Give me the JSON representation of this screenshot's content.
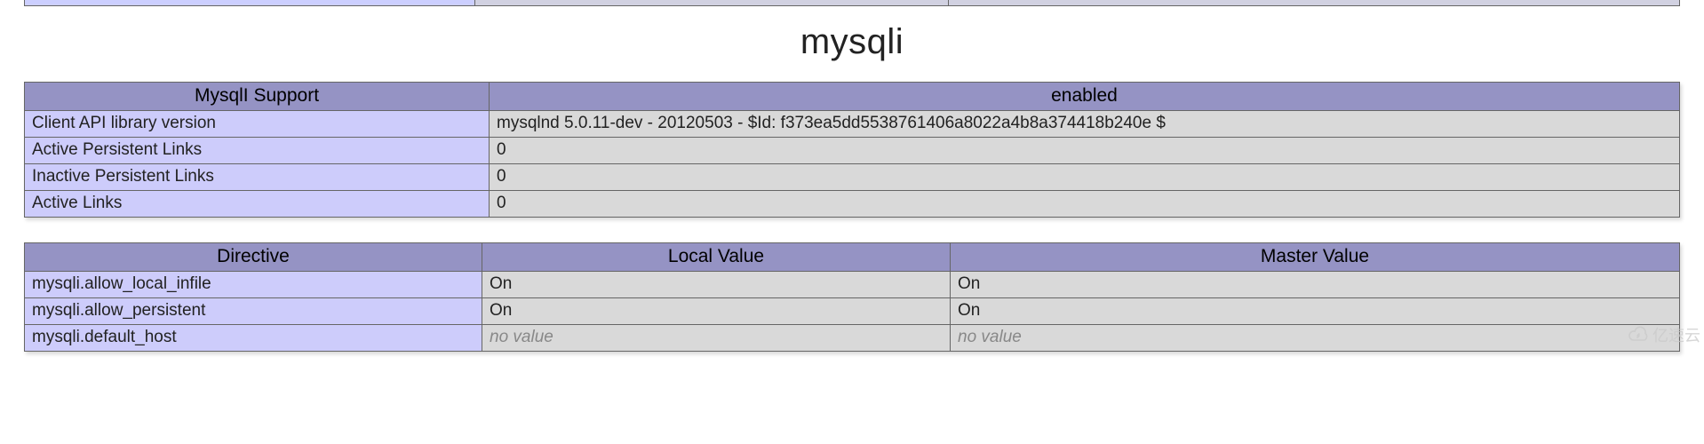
{
  "section_title": "mysqli",
  "support_table": {
    "header_left": "MysqlI Support",
    "header_right": "enabled",
    "rows": [
      {
        "key": "Client API library version",
        "val": "mysqlnd 5.0.11-dev - 20120503 - $Id: f373ea5dd5538761406a8022a4b8a374418b240e $"
      },
      {
        "key": "Active Persistent Links",
        "val": "0"
      },
      {
        "key": "Inactive Persistent Links",
        "val": "0"
      },
      {
        "key": "Active Links",
        "val": "0"
      }
    ]
  },
  "directives_table": {
    "col_directive": "Directive",
    "col_local": "Local Value",
    "col_master": "Master Value",
    "rows": [
      {
        "directive": "mysqli.allow_local_infile",
        "local": "On",
        "master": "On",
        "novalue": false
      },
      {
        "directive": "mysqli.allow_persistent",
        "local": "On",
        "master": "On",
        "novalue": false
      },
      {
        "directive": "mysqli.default_host",
        "local": "no value",
        "master": "no value",
        "novalue": true
      }
    ]
  },
  "watermark": "亿速云"
}
